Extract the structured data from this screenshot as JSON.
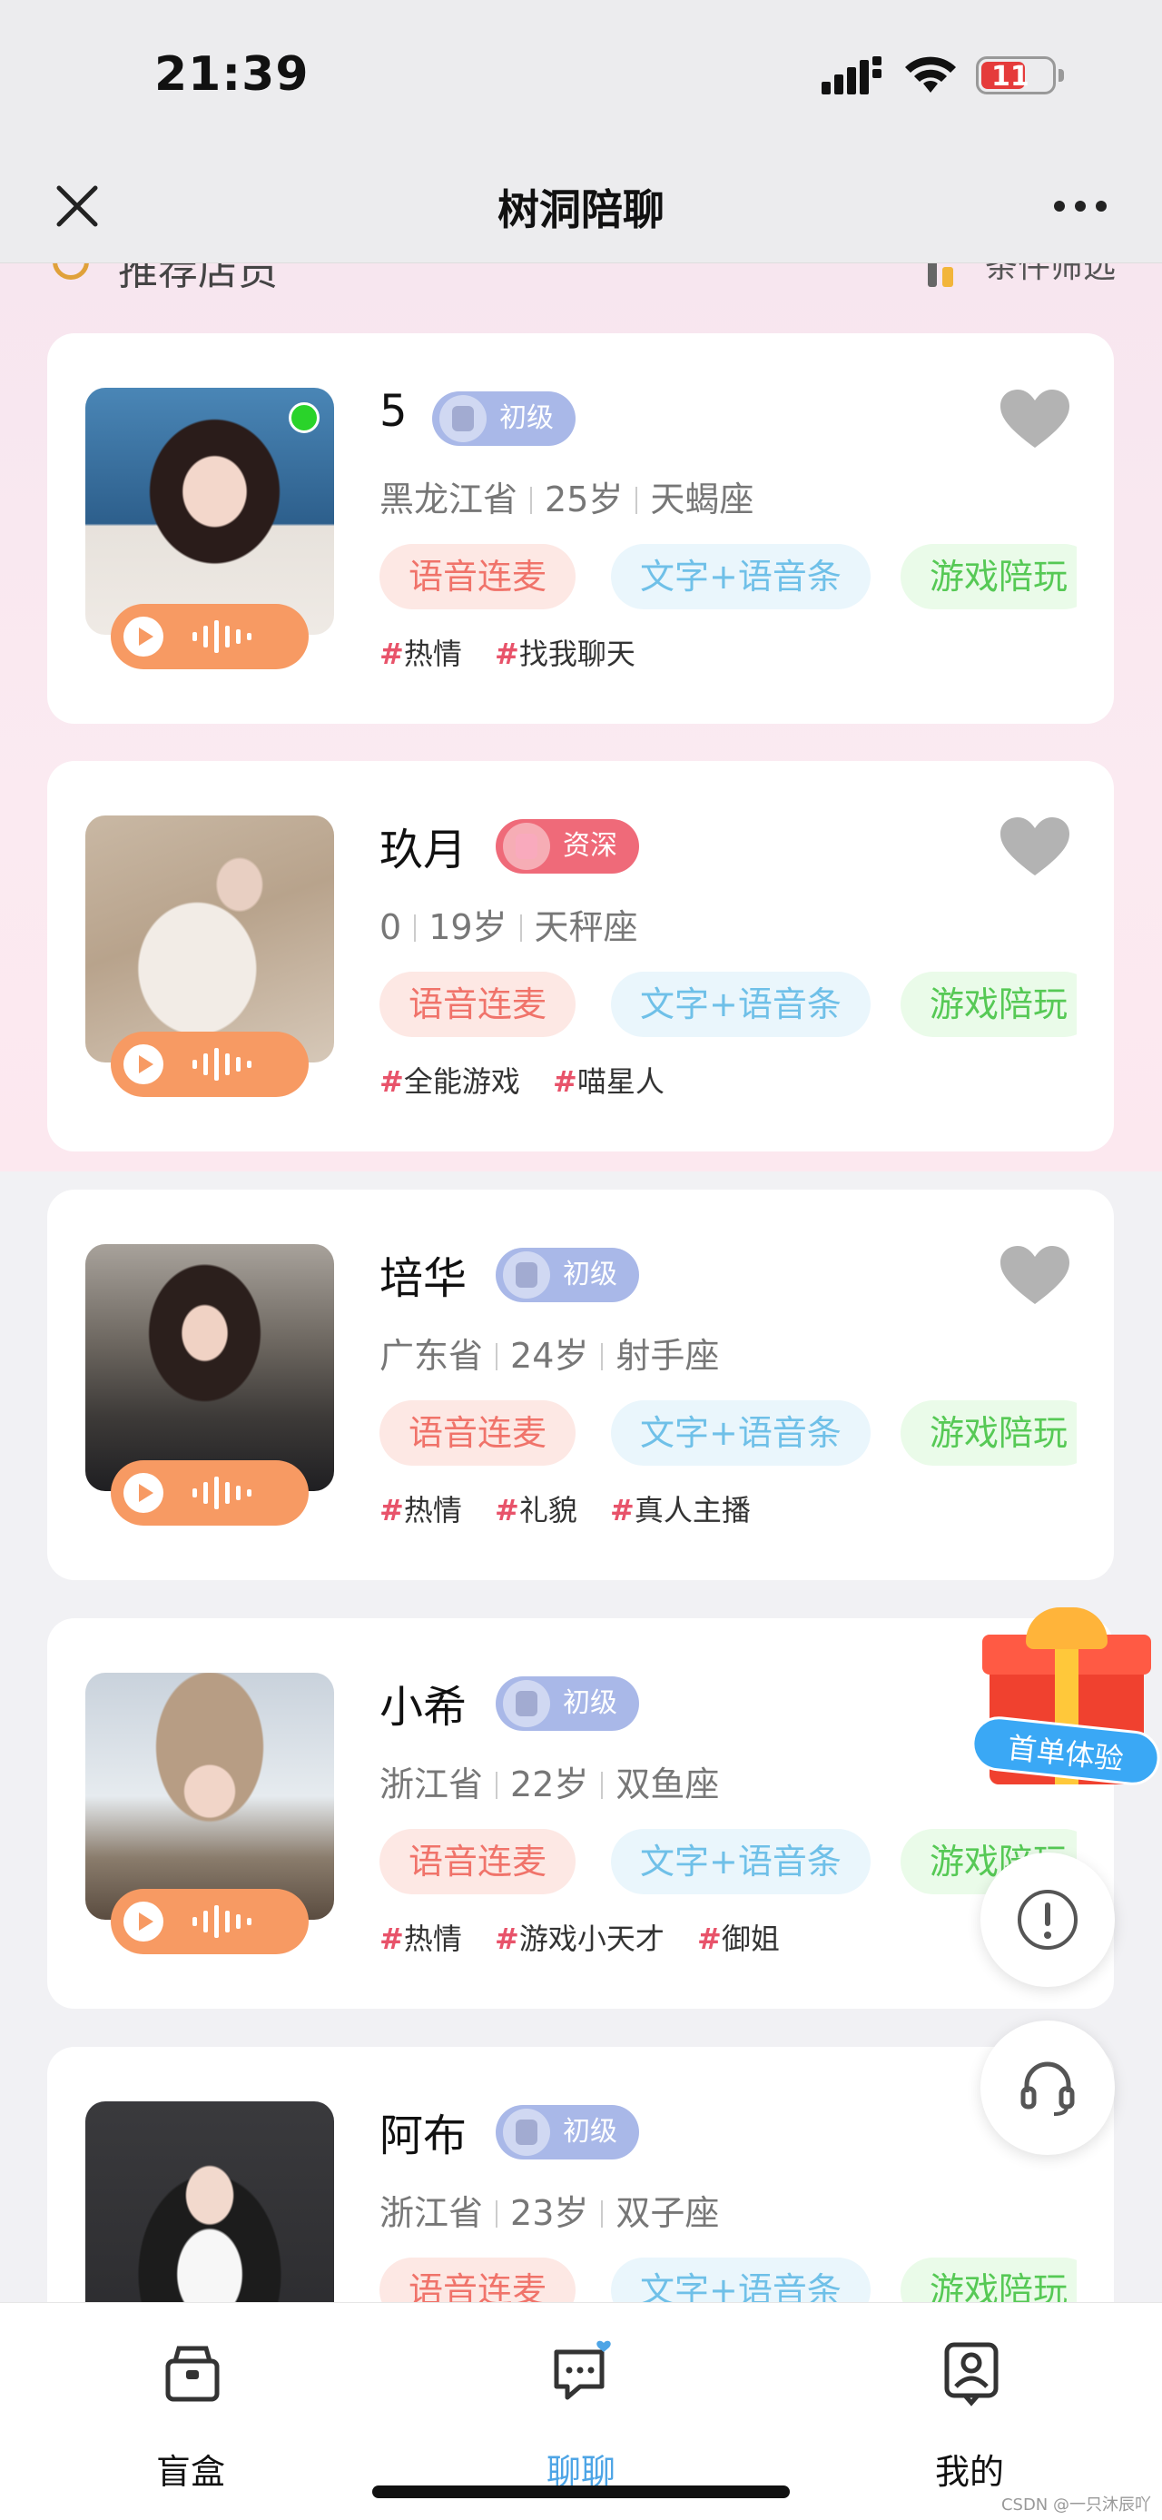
{
  "status": {
    "time": "21:39",
    "battery": "11"
  },
  "nav": {
    "title": "树洞陪聊"
  },
  "section": {
    "title": "推荐店员",
    "filter": "条件筛选"
  },
  "cards": [
    {
      "name": "5",
      "level": "初级",
      "province": "黑龙江省",
      "age": "25岁",
      "zodiac": "天蝎座",
      "services": [
        "语音连麦",
        "文字+语音条",
        "游戏陪玩"
      ],
      "tags": [
        "热情",
        "找我聊天"
      ],
      "online": true
    },
    {
      "name": "玖月",
      "level": "资深",
      "province": "0",
      "age": "19岁",
      "zodiac": "天秤座",
      "services": [
        "语音连麦",
        "文字+语音条",
        "游戏陪玩"
      ],
      "tags": [
        "全能游戏",
        "喵星人"
      ],
      "online": false
    },
    {
      "name": "培华",
      "level": "初级",
      "province": "广东省",
      "age": "24岁",
      "zodiac": "射手座",
      "services": [
        "语音连麦",
        "文字+语音条",
        "游戏陪玩"
      ],
      "tags": [
        "热情",
        "礼貌",
        "真人主播"
      ],
      "online": false
    },
    {
      "name": "小希",
      "level": "初级",
      "province": "浙江省",
      "age": "22岁",
      "zodiac": "双鱼座",
      "services": [
        "语音连麦",
        "文字+语音条",
        "游戏陪玩"
      ],
      "tags": [
        "热情",
        "游戏小天才",
        "御姐"
      ],
      "online": false
    },
    {
      "name": "阿布",
      "level": "初级",
      "province": "浙江省",
      "age": "23岁",
      "zodiac": "双子座",
      "services": [
        "语音连麦",
        "文字+语音条",
        "游戏陪玩"
      ],
      "tags": [],
      "online": false
    }
  ],
  "floating": {
    "gift_label": "首单体验"
  },
  "tabbar": {
    "items": [
      {
        "label": "盲盒"
      },
      {
        "label": "聊聊"
      },
      {
        "label": "我的"
      }
    ]
  },
  "watermark": "CSDN @一只沐辰吖",
  "colors": {
    "accent_orange": "#f79a63",
    "tab_active": "#4ea5e6",
    "online": "#2ad32a"
  }
}
